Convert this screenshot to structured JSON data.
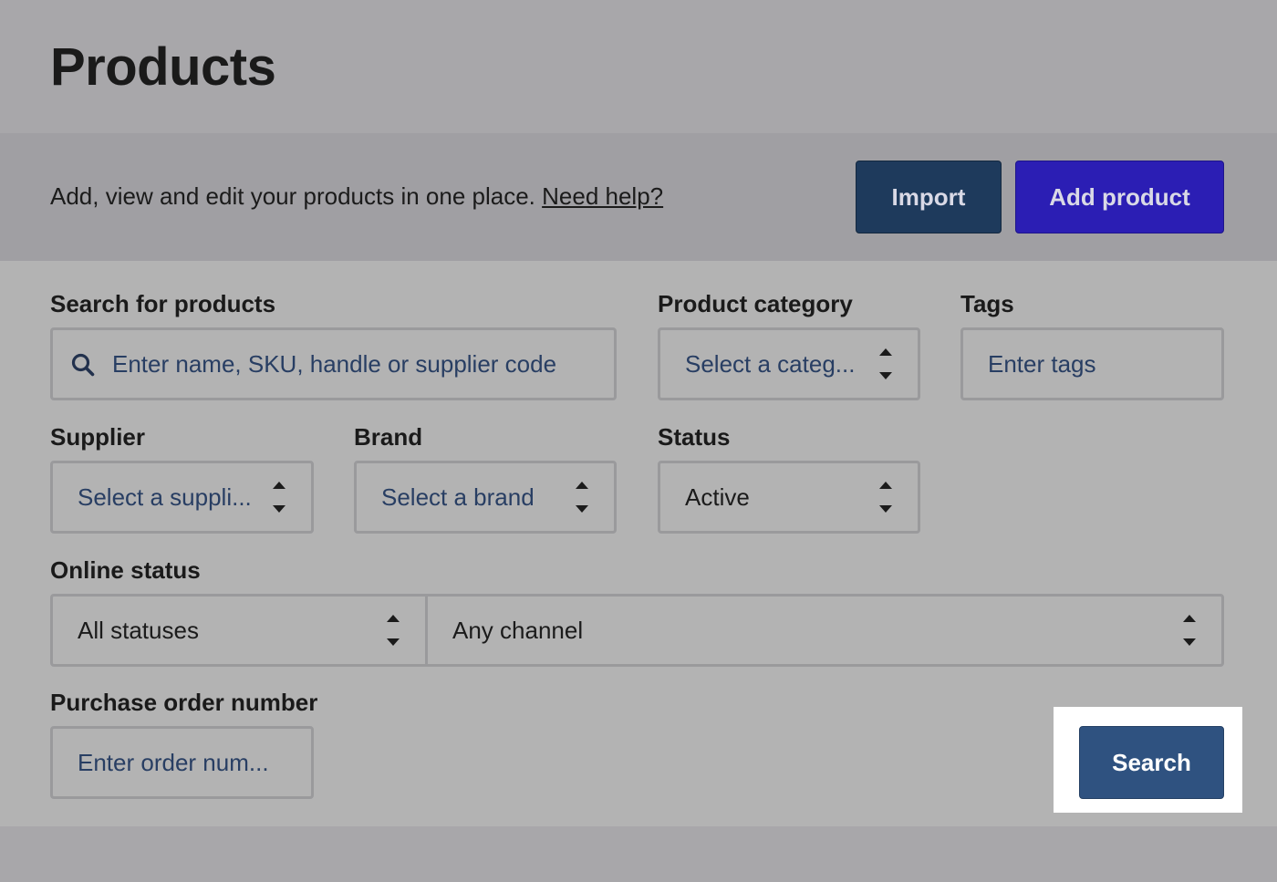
{
  "page": {
    "title": "Products"
  },
  "intro": {
    "text": "Add, view and edit your products in one place.",
    "help_link": "Need help?",
    "import_label": "Import",
    "add_product_label": "Add product"
  },
  "filters": {
    "search": {
      "label": "Search for products",
      "placeholder": "Enter name, SKU, handle or supplier code",
      "icon": "search-icon"
    },
    "category": {
      "label": "Product category",
      "placeholder": "Select a categ..."
    },
    "tags": {
      "label": "Tags",
      "placeholder": "Enter tags"
    },
    "supplier": {
      "label": "Supplier",
      "placeholder": "Select a suppli..."
    },
    "brand": {
      "label": "Brand",
      "placeholder": "Select a brand"
    },
    "status": {
      "label": "Status",
      "value": "Active"
    },
    "online_status": {
      "label": "Online status",
      "status_value": "All statuses",
      "channel_value": "Any channel"
    },
    "purchase_order": {
      "label": "Purchase order number",
      "placeholder": "Enter order num..."
    },
    "search_button": "Search"
  },
  "colors": {
    "import_button": "#1e3a5c",
    "add_product_button": "#2b1eb4",
    "search_button": "#2f5280",
    "placeholder_text": "#283e63"
  }
}
